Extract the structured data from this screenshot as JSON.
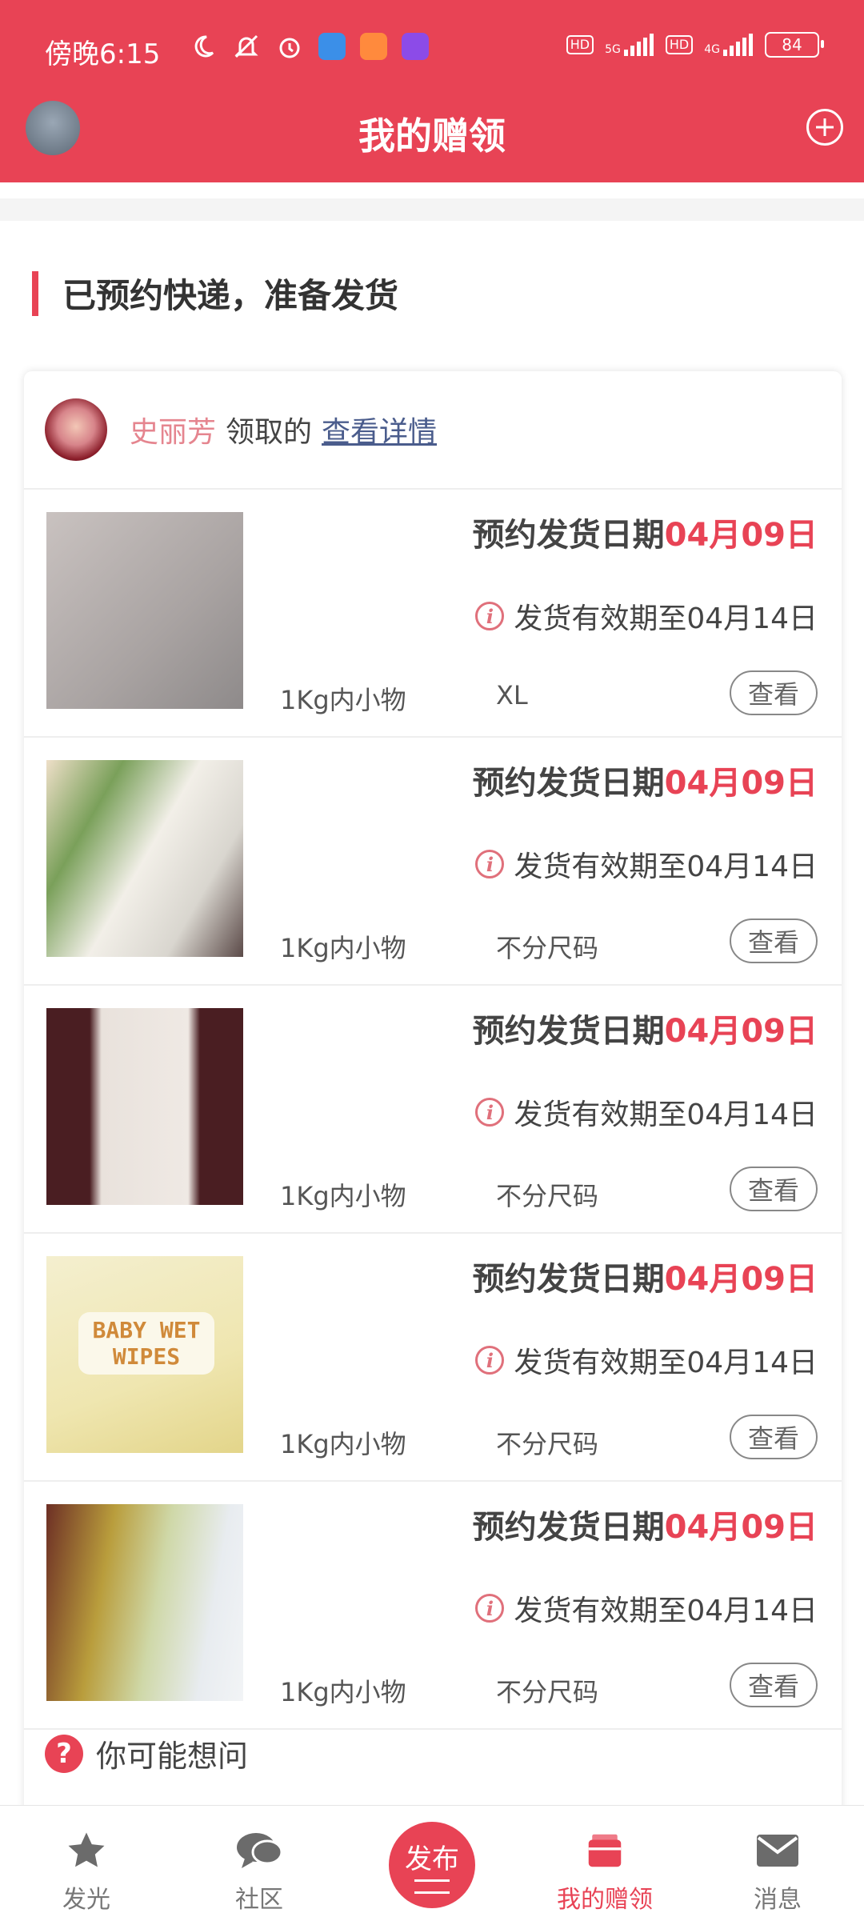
{
  "status_bar": {
    "time": "傍晚6:15",
    "network_1": "5G",
    "network_2": "4G",
    "hd_1": "HD",
    "hd_2": "HD",
    "battery": "84"
  },
  "header": {
    "title": "我的赠领",
    "add_icon": "plus-circle-icon"
  },
  "section": {
    "title": "已预约快递，准备发货"
  },
  "card": {
    "receiver_name": "史丽芳",
    "received_text": "领取的",
    "detail_link": "查看详情",
    "items": [
      {
        "ship_label": "预约发货日期",
        "ship_date": "04月09日",
        "valid_text": "发货有效期至04月14日",
        "weight": "1Kg内小物",
        "size": "XL",
        "view": "查看"
      },
      {
        "ship_label": "预约发货日期",
        "ship_date": "04月09日",
        "valid_text": "发货有效期至04月14日",
        "weight": "1Kg内小物",
        "size": "不分尺码",
        "view": "查看"
      },
      {
        "ship_label": "预约发货日期",
        "ship_date": "04月09日",
        "valid_text": "发货有效期至04月14日",
        "weight": "1Kg内小物",
        "size": "不分尺码",
        "view": "查看"
      },
      {
        "ship_label": "预约发货日期",
        "ship_date": "04月09日",
        "valid_text": "发货有效期至04月14日",
        "weight": "1Kg内小物",
        "size": "不分尺码",
        "view": "查看",
        "image_text": "BABY WET WIPES"
      },
      {
        "ship_label": "预约发货日期",
        "ship_date": "04月09日",
        "valid_text": "发货有效期至04月14日",
        "weight": "1Kg内小物",
        "size": "不分尺码",
        "view": "查看"
      }
    ]
  },
  "faq": {
    "text": "你可能想问"
  },
  "tabbar": {
    "tabs": [
      {
        "label": "发光",
        "icon": "star-icon"
      },
      {
        "label": "社区",
        "icon": "chat-bubbles-icon"
      },
      {
        "label": "发布",
        "icon": "publish-icon"
      },
      {
        "label": "我的赠领",
        "icon": "gift-box-icon",
        "active": true
      },
      {
        "label": "消息",
        "icon": "envelope-icon"
      }
    ]
  },
  "colors": {
    "brand": "#e84355",
    "link": "#4a5c8c",
    "receiver_name": "#e5858f"
  }
}
